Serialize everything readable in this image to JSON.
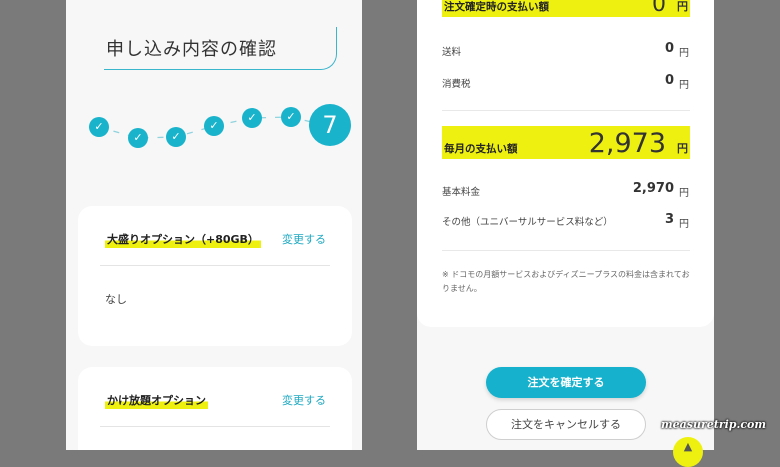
{
  "left": {
    "title": "申し込み内容の確認",
    "stepper": {
      "completed_icon": "check-icon",
      "current_step": "7",
      "completed_count": 6
    },
    "options": [
      {
        "title": "大盛りオプション（+80GB）",
        "link": "変更する",
        "value": "なし"
      },
      {
        "title": "かけ放題オプション",
        "link": "変更する"
      }
    ]
  },
  "right": {
    "initial_payment": {
      "label": "注文確定時の支払い額",
      "amount": "0",
      "yen": "円"
    },
    "initial_rows": [
      {
        "label": "送料",
        "value": "0",
        "yen": "円"
      },
      {
        "label": "消費税",
        "value": "0",
        "yen": "円"
      }
    ],
    "monthly_payment": {
      "label": "毎月の支払い額",
      "amount": "2,973",
      "yen": "円"
    },
    "monthly_rows": [
      {
        "label": "基本料金",
        "value": "2,970",
        "yen": "円"
      },
      {
        "label": "その他（ユニバーサルサービス料など）",
        "value": "3",
        "yen": "円"
      }
    ],
    "note": "※ ドコモの月額サービスおよびディズニープラスの料金は含まれておりません。",
    "confirm_button": "注文を確定する",
    "cancel_button": "注文をキャンセルする"
  },
  "watermark": "measuretrip.com",
  "scroll_top_icon": "chevron-up-icon",
  "colors": {
    "accent": "#1ab3cc",
    "highlight": "#eef10f",
    "background": "#7a7a7a"
  }
}
